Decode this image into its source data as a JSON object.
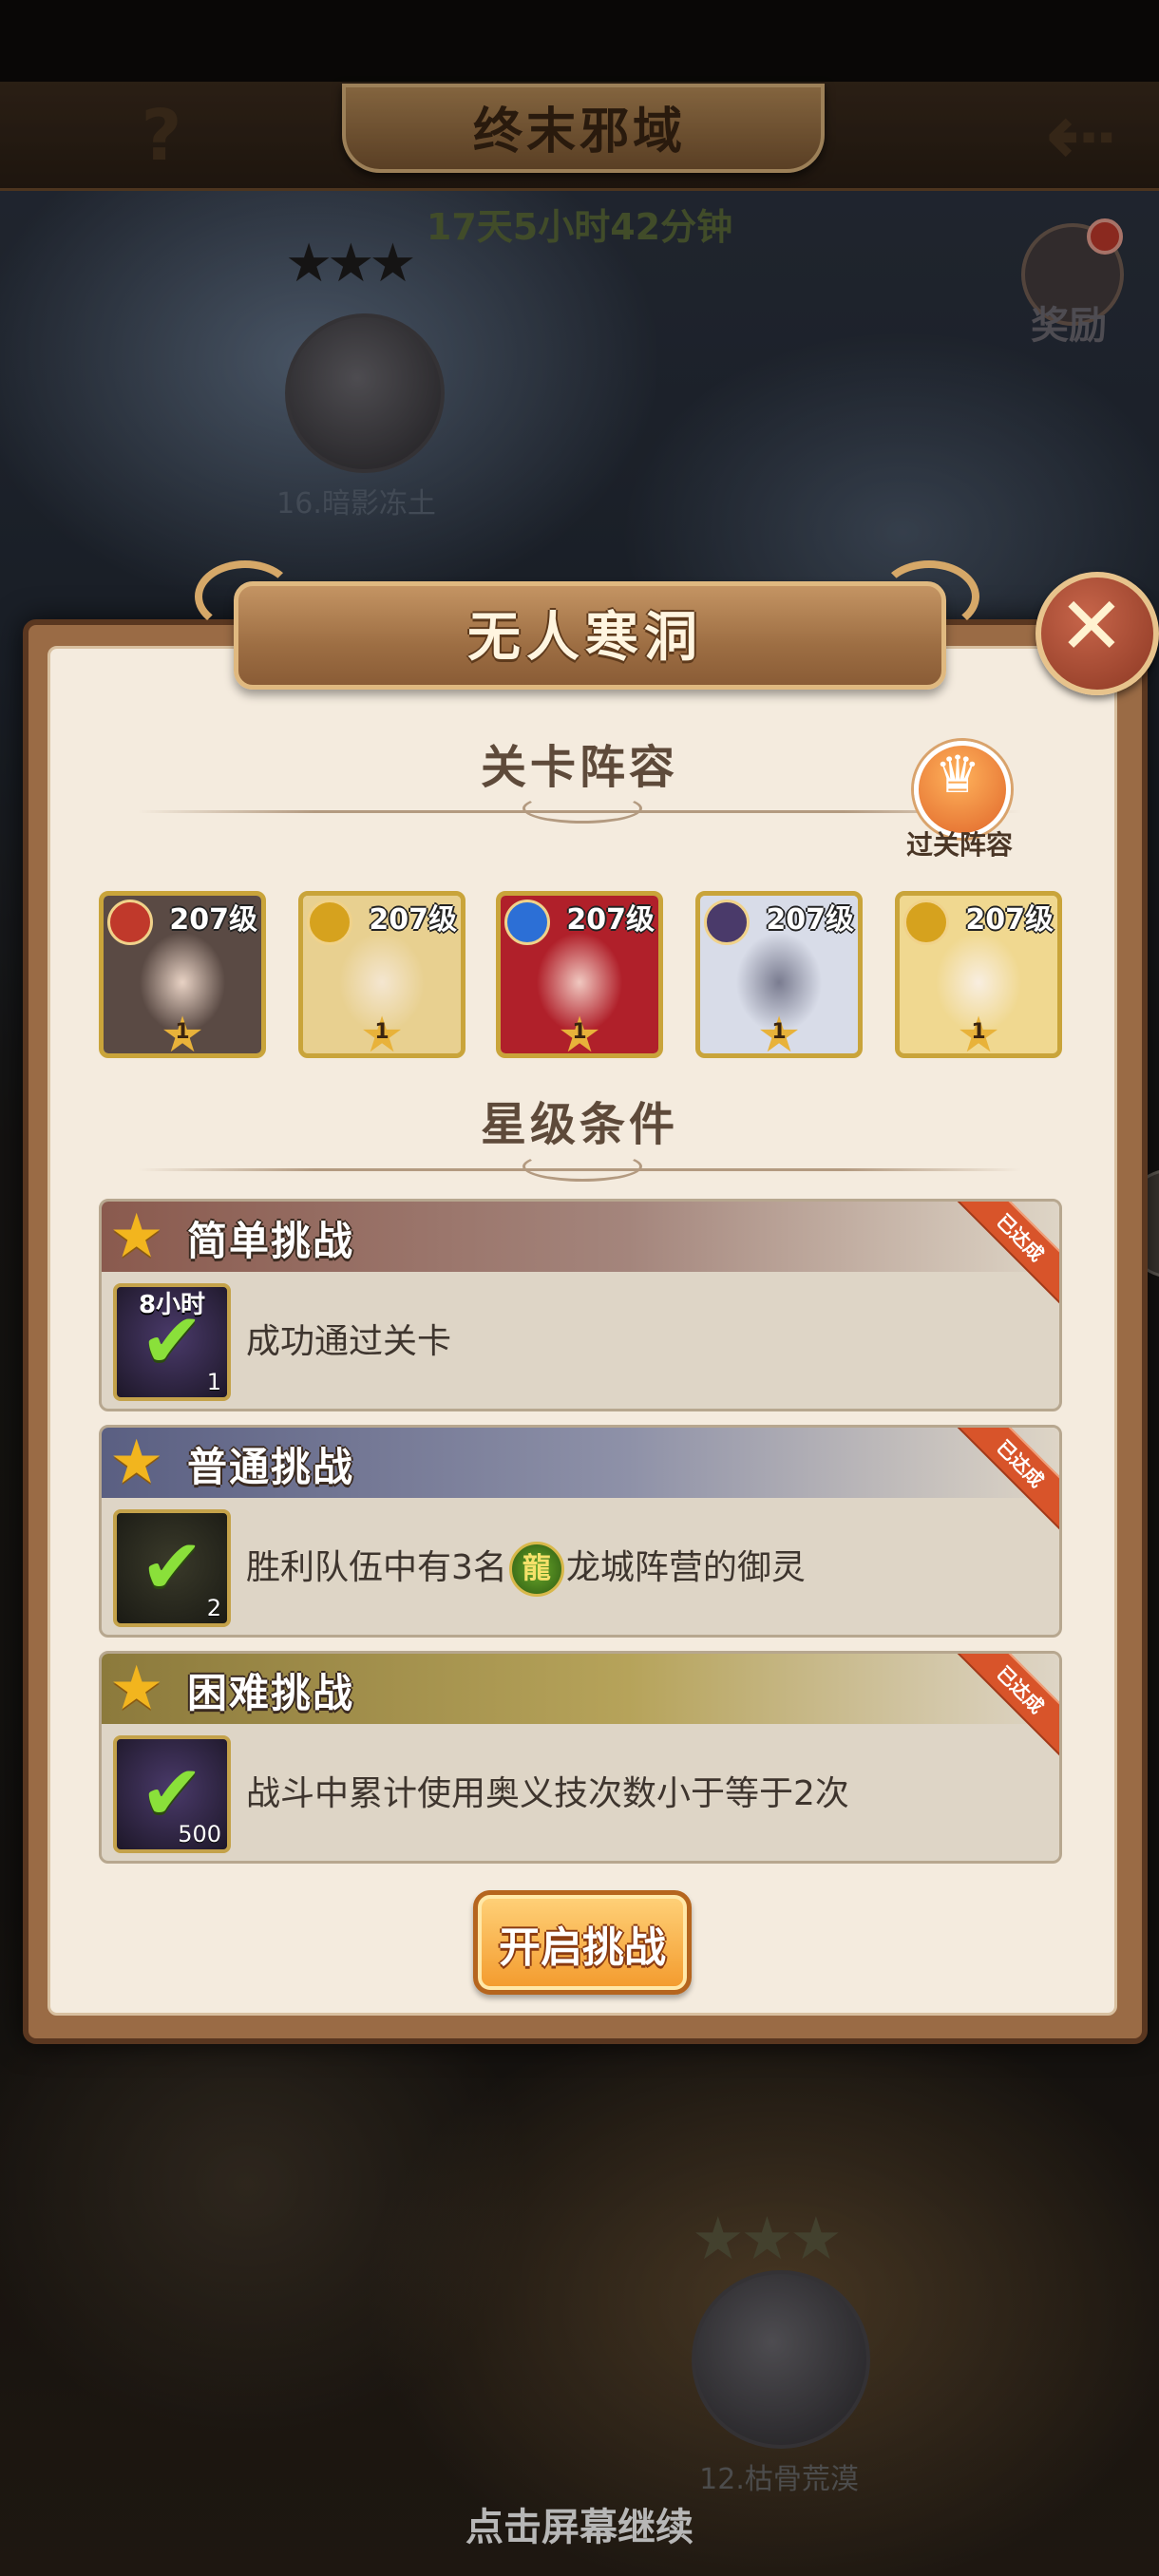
{
  "top_bar": {
    "title": "终末邪域",
    "help_icon": "question-mark-icon",
    "back_icon": "arrow-back-icon",
    "timer": "17天5小时42分钟"
  },
  "reward": {
    "label": "奖励",
    "icon": "reward-badge-icon"
  },
  "map": {
    "stage_top": {
      "label": "16.暗影冻土",
      "stars": "★★★"
    },
    "stage_bottom": {
      "label": "12.枯骨荒漠",
      "stars": "★★★"
    }
  },
  "continue_hint": "点击屏幕继续",
  "dialog": {
    "title": "无人寒洞",
    "close_icon": "close-icon",
    "lineup_title": "关卡阵容",
    "lineup_button_label": "过关阵容",
    "lineup_button_icon": "crown-icon",
    "heroes": [
      {
        "level": "207级",
        "rank": "1",
        "element_color": "#c0392b",
        "portrait_colors": [
          "#5a4a44",
          "#e8d2c4"
        ]
      },
      {
        "level": "207级",
        "rank": "1",
        "element_color": "#d6a21e",
        "portrait_colors": [
          "#e8d090",
          "#f4e6d0"
        ]
      },
      {
        "level": "207级",
        "rank": "1",
        "element_color": "#2c6fd6",
        "portrait_colors": [
          "#b0202a",
          "#f0c8c0"
        ]
      },
      {
        "level": "207级",
        "rank": "1",
        "element_color": "#4a3a6a",
        "portrait_colors": [
          "#d8dce8",
          "#7a7c90"
        ]
      },
      {
        "level": "207级",
        "rank": "1",
        "element_color": "#d6a21e",
        "portrait_colors": [
          "#f0d890",
          "#f8eee0"
        ]
      }
    ],
    "star_title": "星级条件",
    "challenges": [
      {
        "title": "简单挑战",
        "ribbon": "已达成",
        "icon_top_text": "8小时",
        "icon_qty": "1",
        "desc": "成功通过关卡"
      },
      {
        "title": "普通挑战",
        "ribbon": "已达成",
        "icon_qty": "2",
        "desc_before": "胜利队伍中有3名",
        "faction_icon": "dragon-faction-icon",
        "desc_after": "龙城阵营的御灵"
      },
      {
        "title": "困难挑战",
        "ribbon": "已达成",
        "icon_qty": "500",
        "desc": "战斗中累计使用奥义技次数小于等于2次"
      }
    ],
    "start_button": "开启挑战"
  }
}
